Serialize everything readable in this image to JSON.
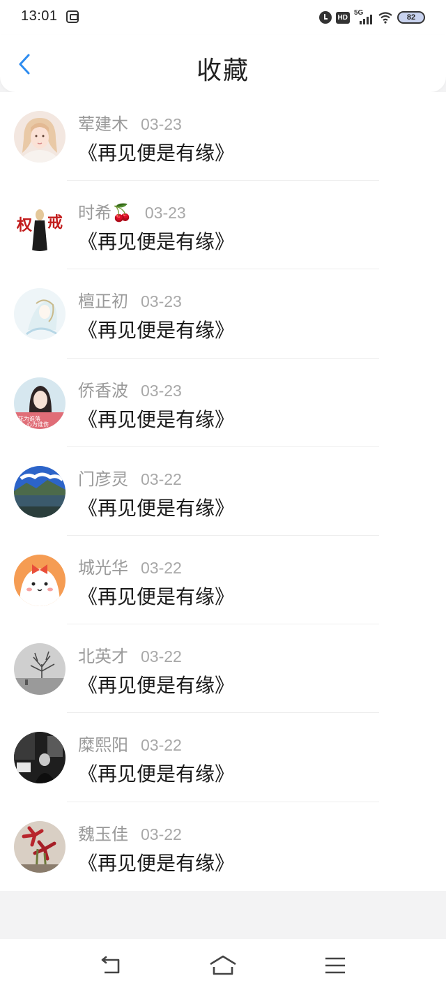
{
  "status_bar": {
    "time": "13:01",
    "hd_label": "HD",
    "network_label": "5G",
    "battery_level": "82",
    "icons": [
      "screen-mirror-icon",
      "alarm-icon",
      "hd-icon",
      "signal-icon",
      "wifi-icon",
      "battery-icon"
    ]
  },
  "header": {
    "title": "收藏",
    "back_icon": "chevron-left-icon",
    "accent_color": "#2d8cf0"
  },
  "favorites": [
    {
      "name": "荤建木",
      "date": "03-23",
      "title": "《再见便是有缘》",
      "avatar": "avatar-girl-portrait"
    },
    {
      "name": "时希🍒",
      "date": "03-23",
      "title": "《再见便是有缘》",
      "avatar": "avatar-calligraphy-figure"
    },
    {
      "name": "檀正初",
      "date": "03-23",
      "title": "《再见便是有缘》",
      "avatar": "avatar-anime-sketch"
    },
    {
      "name": "侨香波",
      "date": "03-23",
      "title": "《再见便是有缘》",
      "avatar": "avatar-girl-pink"
    },
    {
      "name": "门彦灵",
      "date": "03-22",
      "title": "《再见便是有缘》",
      "avatar": "avatar-landscape-lake"
    },
    {
      "name": "城光华",
      "date": "03-22",
      "title": "《再见便是有缘》",
      "avatar": "avatar-cartoon-dog"
    },
    {
      "name": "北英才",
      "date": "03-22",
      "title": "《再见便是有缘》",
      "avatar": "avatar-bw-tree"
    },
    {
      "name": "糜熙阳",
      "date": "03-22",
      "title": "《再见便是有缘》",
      "avatar": "avatar-bw-street"
    },
    {
      "name": "魏玉佳",
      "date": "03-22",
      "title": "《再见便是有缘》",
      "avatar": "avatar-red-flowers"
    }
  ],
  "nav_bar": {
    "icons": [
      "back-nav-icon",
      "home-nav-icon",
      "menu-nav-icon"
    ]
  }
}
